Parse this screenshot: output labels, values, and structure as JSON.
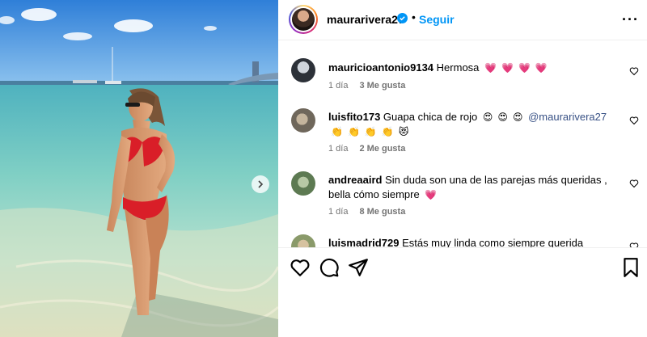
{
  "post": {
    "username": "maurarivera27",
    "separator": "•",
    "follow_label": "Seguir",
    "more_label": "···"
  },
  "comments": [
    {
      "user": "mauricioantonio9134",
      "text": "Hermosa",
      "emojis": [
        "💗",
        "💗",
        "💗",
        "💗"
      ],
      "time": "1 día",
      "likes": "3 Me gusta"
    },
    {
      "user": "luisfito173",
      "text": "Guapa chica de rojo",
      "emojis": [
        "😍",
        "😍",
        "😍"
      ],
      "mention": "@maurarivera27",
      "emojis2": [
        "👏",
        "👏",
        "👏",
        "👏",
        "😻"
      ],
      "time": "1 día",
      "likes": "2 Me gusta"
    },
    {
      "user": "andreaaird",
      "text": "Sin duda son una de las parejas más queridas , bella cómo siempre",
      "emojis": [
        "💗"
      ],
      "time": "1 día",
      "likes": "8 Me gusta"
    },
    {
      "user": "luismadrid729",
      "text": "Estás muy linda como siempre querida Maura"
    }
  ],
  "icons": {
    "verified": "verified-badge-icon",
    "like": "heart-icon",
    "comment": "comment-icon",
    "share": "share-icon",
    "save": "bookmark-icon",
    "next": "chevron-right-icon"
  },
  "colors": {
    "accent": "#0095f6",
    "meta": "#737373",
    "bikini": "#d91e28"
  }
}
